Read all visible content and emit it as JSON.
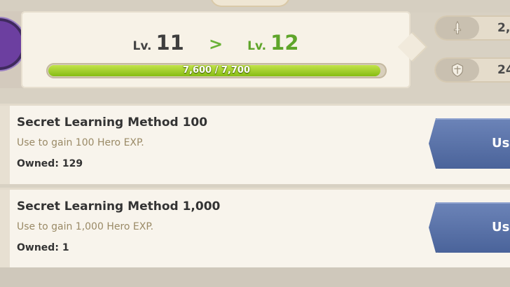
{
  "level": {
    "label": "Lv.",
    "current": "11",
    "next": "12",
    "arrow": ">"
  },
  "exp": {
    "text": "7,600 / 7,700",
    "current": 7600,
    "max": 7700
  },
  "stats": [
    {
      "icon": "sword-icon",
      "value": "2,"
    },
    {
      "icon": "shield-icon",
      "value": "24,"
    }
  ],
  "items": [
    {
      "name": "Secret Learning Method 100",
      "description": "Use to gain 100 Hero EXP.",
      "owned_label": "Owned:",
      "owned": "129",
      "button": "Us"
    },
    {
      "name": "Secret Learning Method 1,000",
      "description": "Use to gain 1,000 Hero EXP.",
      "owned_label": "Owned:",
      "owned": "1",
      "button": "Us"
    }
  ],
  "colors": {
    "accent_green": "#5fa52a",
    "use_button": "#5670a8",
    "exp_fill": "#9ccb22"
  }
}
